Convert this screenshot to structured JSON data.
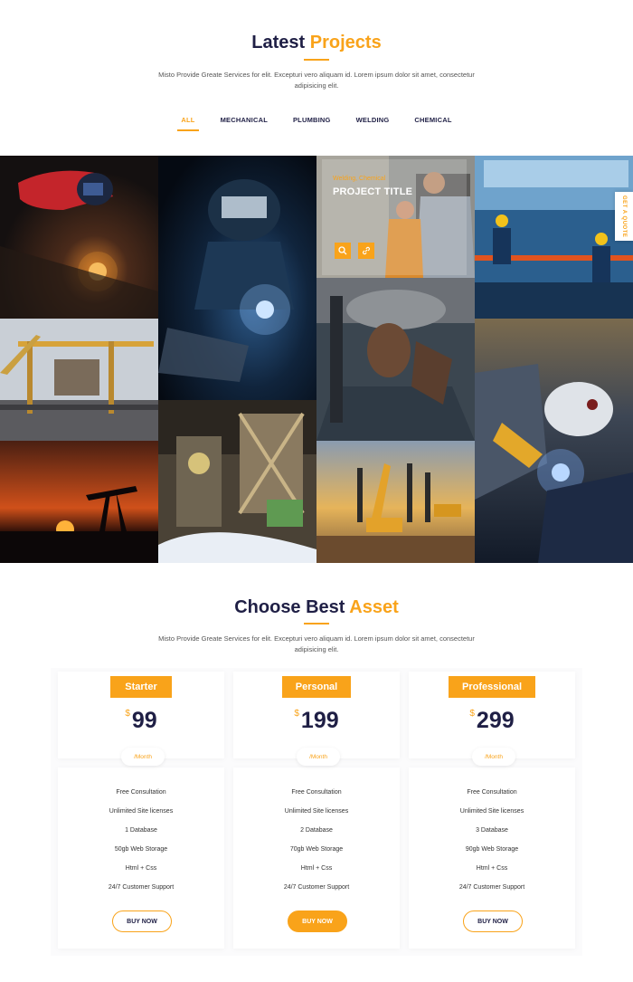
{
  "projects": {
    "title_main": "Latest",
    "title_accent": "Projects",
    "description": "Misto Provide Greate Services for elit. Excepturi vero aliquam id. Lorem ipsum dolor sit amet, consectetur adipisicing elit.",
    "filters": [
      "ALL",
      "MECHANICAL",
      "PLUMBING",
      "WELDING",
      "CHEMICAL"
    ],
    "active_filter": "ALL",
    "overlay": {
      "category": "Welding, Chemical",
      "title": "PROJECT TITLE",
      "zoom_icon": "search-icon",
      "link_icon": "link-icon"
    },
    "quote_tab": "GET A QUOTE"
  },
  "pricing": {
    "title_main": "Choose Best",
    "title_accent": "Asset",
    "description": "Misto Provide Greate Services for elit. Excepturi vero aliquam id. Lorem ipsum dolor sit amet, consectetur adipisicing elit.",
    "plans": [
      {
        "name": "Starter",
        "currency": "$",
        "price": "99",
        "period": "/Month",
        "features": [
          "Free Consultation",
          "Unlimited Site licenses",
          "1 Database",
          "50gb Web Storage",
          "Html + Css",
          "24/7 Customer Support"
        ],
        "button": "BUY NOW"
      },
      {
        "name": "Personal",
        "currency": "$",
        "price": "199",
        "period": "/Month",
        "features": [
          "Free Consultation",
          "Unlimited Site licenses",
          "2 Database",
          "70gb Web Storage",
          "Html + Css",
          "24/7 Customer Support"
        ],
        "button": "BUY NOW"
      },
      {
        "name": "Professional",
        "currency": "$",
        "price": "299",
        "period": "/Month",
        "features": [
          "Free Consultation",
          "Unlimited Site licenses",
          "3 Database",
          "90gb Web Storage",
          "Html + Css",
          "24/7 Customer Support"
        ],
        "button": "BUY NOW"
      }
    ]
  },
  "colors": {
    "accent": "#f9a31a",
    "heading": "#1f1f45"
  }
}
